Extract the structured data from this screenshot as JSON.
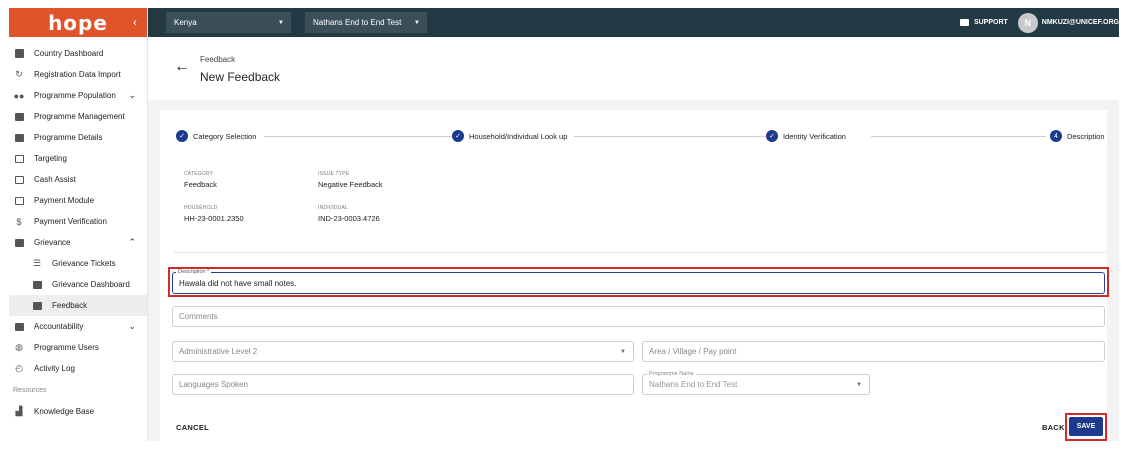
{
  "logo": "hope",
  "sidebar": {
    "items": [
      {
        "label": "Country Dashboard",
        "icon": "dashboard-icon"
      },
      {
        "label": "Registration Data Import",
        "icon": "refresh-icon"
      },
      {
        "label": "Programme Population",
        "icon": "people-icon",
        "expandable": true
      },
      {
        "label": "Programme Management",
        "icon": "document-icon"
      },
      {
        "label": "Programme Details",
        "icon": "document-icon"
      },
      {
        "label": "Targeting",
        "icon": "list-icon"
      },
      {
        "label": "Cash Assist",
        "icon": "card-icon"
      },
      {
        "label": "Payment Module",
        "icon": "card-icon"
      },
      {
        "label": "Payment Verification",
        "icon": "dollar-icon"
      },
      {
        "label": "Grievance",
        "icon": "report-icon",
        "expanded": true
      }
    ],
    "grievance_sub": [
      {
        "label": "Grievance Tickets",
        "icon": "list-icon"
      },
      {
        "label": "Grievance Dashboard",
        "icon": "chart-icon"
      },
      {
        "label": "Feedback",
        "icon": "feedback-icon",
        "active": true
      }
    ],
    "items_after": [
      {
        "label": "Accountability",
        "icon": "chat-icon",
        "expandable": true
      },
      {
        "label": "Programme Users",
        "icon": "globe-icon"
      },
      {
        "label": "Activity Log",
        "icon": "history-icon"
      }
    ],
    "resources_label": "Resources",
    "knowledge_base": "Knowledge Base"
  },
  "topbar": {
    "country": "Kenya",
    "programme": "Nathans End to End Test",
    "support": "SUPPORT",
    "avatar_initial": "N",
    "user": "NMKUZI@UNICEF.ORG"
  },
  "header": {
    "breadcrumb": "Feedback",
    "title": "New Feedback"
  },
  "stepper": {
    "steps": [
      {
        "label": "Category Selection",
        "state": "done"
      },
      {
        "label": "Household/Individual Look up",
        "state": "done"
      },
      {
        "label": "Identity Verification",
        "state": "done"
      },
      {
        "label": "Description",
        "state": "active",
        "number": "4"
      }
    ]
  },
  "summary": {
    "category_label": "CATEGORY",
    "category_value": "Feedback",
    "issue_type_label": "ISSUE TYPE",
    "issue_type_value": "Negative Feedback",
    "household_label": "HOUSEHOLD",
    "household_value": "HH-23-0001.2350",
    "individual_label": "INDIVIDUAL",
    "individual_value": "IND-23-0003.4726"
  },
  "form": {
    "description_label": "Description *",
    "description_value": "Hawala did not have small notes.",
    "comments_placeholder": "Comments",
    "admin_level_placeholder": "Administrative Level 2",
    "area_placeholder": "Area / Village / Pay point",
    "languages_placeholder": "Languages Spoken",
    "programme_name_label": "Programme Name",
    "programme_name_value": "Nathans End to End Test"
  },
  "actions": {
    "cancel": "CANCEL",
    "back": "BACK",
    "save": "SAVE"
  },
  "colors": {
    "brand": "#e0542b",
    "topbar": "#233944",
    "primary": "#1c3b8c",
    "highlight": "#d12b2b"
  }
}
